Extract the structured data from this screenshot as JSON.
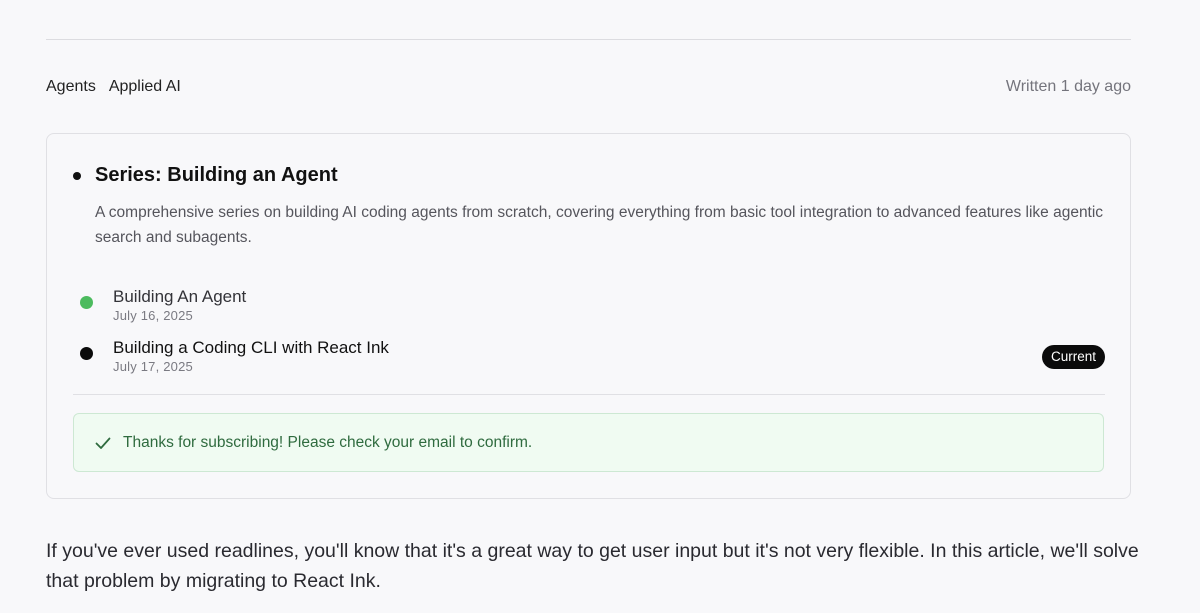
{
  "meta": {
    "tags": [
      "Agents",
      "Applied AI"
    ],
    "written": "Written 1 day ago"
  },
  "series": {
    "title": "Series: Building an Agent",
    "description": "A comprehensive series on building AI coding agents from scratch, covering everything from basic tool integration to advanced features like agentic search and subagents.",
    "posts": [
      {
        "title": "Building An Agent",
        "date": "July 16, 2025",
        "dot_color": "#4cbb5e",
        "current": false
      },
      {
        "title": "Building a Coding CLI with React Ink",
        "date": "July 17, 2025",
        "dot_color": "#0b0b0b",
        "current": true
      }
    ],
    "current_badge": "Current"
  },
  "subscribe": {
    "message": "Thanks for subscribing! Please check your email to confirm.",
    "icon": "check-icon"
  },
  "article": {
    "intro": "If you've ever used readlines, you'll know that it's a great way to get user input but it's not very flexible. In this article, we'll solve that problem by migrating to React Ink."
  }
}
